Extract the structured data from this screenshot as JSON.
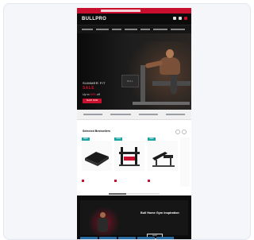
{
  "brand": {
    "logo": "BULLPRO",
    "accent": "#c8102e",
    "dark": "#0b0b0b"
  },
  "promo_bar": {
    "text": ""
  },
  "header": {
    "icons": [
      "search-icon",
      "account-icon",
      "cart-icon"
    ]
  },
  "nav": {
    "items": [
      "",
      "",
      "",
      "",
      "",
      "",
      ""
    ]
  },
  "hero": {
    "eyebrow": "SUMMER FIT",
    "title": "SALE",
    "subtitle_pre": "Up to",
    "subtitle_highlight": "60%",
    "subtitle_post": "off",
    "cta": "SHOP NOW",
    "machine_label": "BULL"
  },
  "benefits": {
    "items": [
      "",
      "",
      "",
      ""
    ]
  },
  "best_sellers": {
    "title": "Selected Bestsellers",
    "products": [
      {
        "badge": "NEW",
        "name": "",
        "price": "",
        "old_price": ""
      },
      {
        "badge": "NEW",
        "name": "",
        "price": "",
        "old_price": ""
      },
      {
        "badge": "NEW",
        "name": "",
        "price": "",
        "old_price": ""
      }
    ]
  },
  "promo": {
    "title": "Bull Home Gym Inspiration",
    "text": "",
    "button": "SHOP"
  }
}
